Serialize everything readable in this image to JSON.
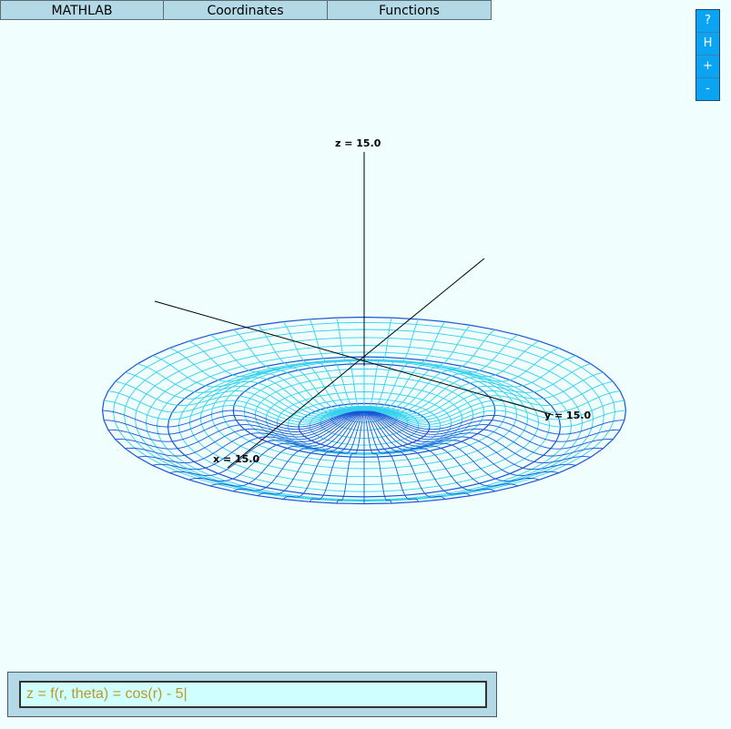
{
  "menu": {
    "items": [
      "MATHLAB",
      "Coordinates",
      "Functions"
    ]
  },
  "tools": [
    "?",
    "H",
    "+",
    "-"
  ],
  "plot": {
    "axes": {
      "z_label": "z = 15.0",
      "y_label": "y = 15.0",
      "x_label": "x = 15.0"
    },
    "colors": {
      "mesh_light": "#33d0ee",
      "mesh_dark": "#1a55d6",
      "axis": "#000000"
    }
  },
  "formula": {
    "value": "z = f(r, theta) = cos(r) - 5|"
  }
}
